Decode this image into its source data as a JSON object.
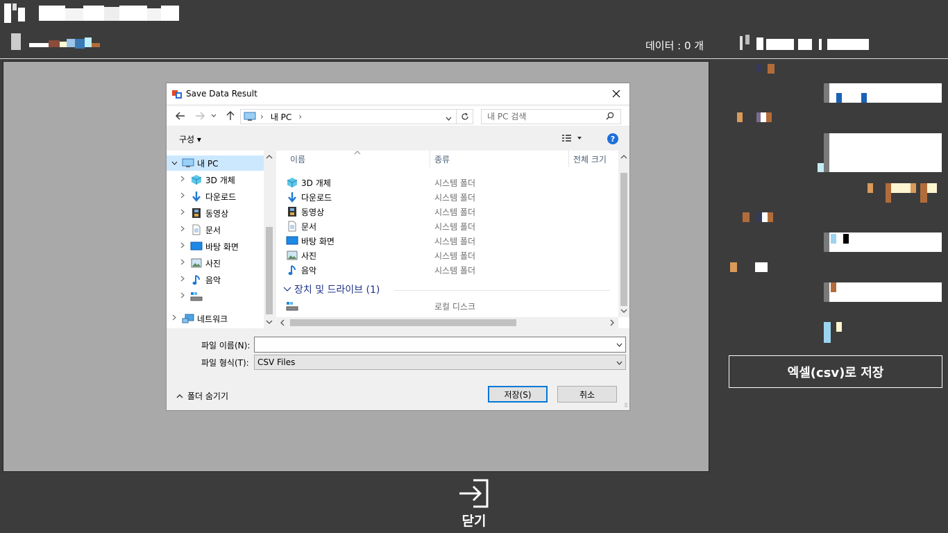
{
  "app": {
    "title_text": "",
    "data_count": "데이터 : 0 개"
  },
  "right_panel": {
    "csv_button_label": "엑셀(csv)로 저장"
  },
  "close": {
    "label": "닫기",
    "icon": "exit-icon"
  },
  "dialog": {
    "title": "Save Data Result",
    "address": {
      "crumb": "내 PC",
      "separator": "›"
    },
    "search_placeholder": "내 PC 검색",
    "toolbar": {
      "organize": "구성 ▾",
      "help": "?"
    },
    "nav": [
      {
        "label": "내 PC",
        "icon": "pc-icon",
        "selected": true,
        "expanded": true
      },
      {
        "label": "3D 개체",
        "icon": "cube-icon"
      },
      {
        "label": "다운로드",
        "icon": "download-arrow-icon"
      },
      {
        "label": "동영상",
        "icon": "film-icon"
      },
      {
        "label": "문서",
        "icon": "document-icon"
      },
      {
        "label": "바탕 화면",
        "icon": "desktop-icon"
      },
      {
        "label": "사진",
        "icon": "picture-icon"
      },
      {
        "label": "음악",
        "icon": "music-note-icon"
      },
      {
        "label": "",
        "icon": "drive-icon"
      },
      {
        "label": "네트워크",
        "icon": "network-icon"
      }
    ],
    "columns": {
      "name": "이름",
      "type": "종류",
      "size": "전체 크기"
    },
    "folders": [
      {
        "name": "3D 개체",
        "type": "시스템 폴더",
        "icon": "cube-icon"
      },
      {
        "name": "다운로드",
        "type": "시스템 폴더",
        "icon": "download-arrow-icon"
      },
      {
        "name": "동영상",
        "type": "시스템 폴더",
        "icon": "film-icon"
      },
      {
        "name": "문서",
        "type": "시스템 폴더",
        "icon": "document-icon"
      },
      {
        "name": "바탕 화면",
        "type": "시스템 폴더",
        "icon": "desktop-icon"
      },
      {
        "name": "사진",
        "type": "시스템 폴더",
        "icon": "picture-icon"
      },
      {
        "name": "음악",
        "type": "시스템 폴더",
        "icon": "music-note-icon"
      }
    ],
    "devices_group": "장치 및 드라이브 (1)",
    "devices": [
      {
        "name": "",
        "type": "로컬 디스크",
        "icon": "drive-icon"
      }
    ],
    "filename_label": "파일 이름(N):",
    "filename_value": "",
    "filetype_label": "파일 형식(T):",
    "filetype_value": "CSV Files",
    "hide_folders": "폴더 숨기기",
    "save_label": "저장(S)",
    "cancel_label": "취소"
  },
  "colors": {
    "background": "#3c3c3c",
    "panel": "#a9a9a9",
    "accent": "#0078d7",
    "selection": "#cce8ff"
  }
}
